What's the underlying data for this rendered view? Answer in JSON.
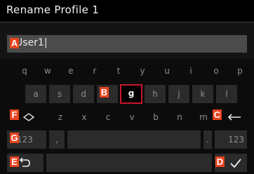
{
  "header": {
    "title": "Rename Profile 1"
  },
  "input": {
    "value": "User1|"
  },
  "keyboard": {
    "row1": [
      "q",
      "w",
      "e",
      "r",
      "t",
      "y",
      "u",
      "i",
      "o",
      "p"
    ],
    "row2": [
      "a",
      "s",
      "d",
      "f",
      "g",
      "h",
      "j",
      "k",
      "l"
    ],
    "row3": [
      "z",
      "x",
      "c",
      "v",
      "b",
      "n",
      "m"
    ],
    "selected_key": "g",
    "numbers_left_label": "123",
    "comma": ",",
    "period": ".",
    "numbers_right_label": "123"
  },
  "callouts": [
    "A",
    "B",
    "C",
    "D",
    "E",
    "F",
    "G"
  ],
  "icons": {
    "shift": "shift-icon",
    "backspace": "backspace-arrow-icon",
    "back": "back-return-icon",
    "confirm": "checkmark-icon"
  }
}
